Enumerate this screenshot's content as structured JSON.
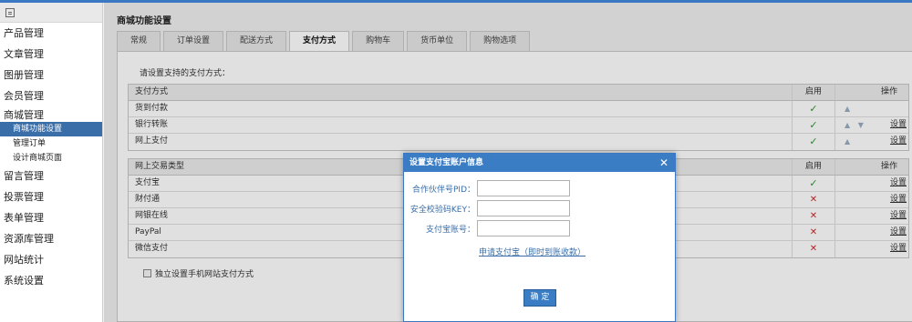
{
  "sidebar": {
    "items": [
      {
        "label": "产品管理"
      },
      {
        "label": "文章管理"
      },
      {
        "label": "图册管理"
      },
      {
        "label": "会员管理"
      },
      {
        "label": "商城管理"
      },
      {
        "label": "留言管理"
      },
      {
        "label": "投票管理"
      },
      {
        "label": "表单管理"
      },
      {
        "label": "资源库管理"
      },
      {
        "label": "网站统计"
      },
      {
        "label": "系统设置"
      }
    ],
    "subitems": [
      {
        "label": "商城功能设置"
      },
      {
        "label": "管理订单"
      },
      {
        "label": "设计商城页面"
      }
    ]
  },
  "page": {
    "title": "商城功能设置"
  },
  "tabs": [
    {
      "label": "常规"
    },
    {
      "label": "订单设置"
    },
    {
      "label": "配送方式"
    },
    {
      "label": "支付方式"
    },
    {
      "label": "购物车"
    },
    {
      "label": "货币单位"
    },
    {
      "label": "购物选项"
    }
  ],
  "panel": {
    "instruction": "请设置支持的支付方式：",
    "table1": {
      "headers": [
        "支付方式",
        "启用",
        "操作"
      ],
      "rows": [
        {
          "name": "货到付款",
          "enabled": true,
          "arrows": "▲",
          "action": ""
        },
        {
          "name": "银行转账",
          "enabled": true,
          "arrows": "▲ ▼",
          "action": "设置"
        },
        {
          "name": "网上支付",
          "enabled": true,
          "arrows": "▲",
          "action": "设置"
        }
      ]
    },
    "table2": {
      "headers": [
        "网上交易类型",
        "启用",
        "操作"
      ],
      "rows": [
        {
          "name": "支付宝",
          "enabled": true,
          "action": "设置"
        },
        {
          "name": "财付通",
          "enabled": false,
          "action": "设置"
        },
        {
          "name": "网银在线",
          "enabled": false,
          "action": "设置"
        },
        {
          "name": "PayPal",
          "enabled": false,
          "action": "设置"
        },
        {
          "name": "微信支付",
          "enabled": false,
          "action": "设置"
        }
      ]
    },
    "mobile_option": "独立设置手机网站支付方式"
  },
  "dialog": {
    "title": "设置支付宝账户信息",
    "close": "✕",
    "fields": {
      "partner_label": "合作伙伴号PID：",
      "key_label": "安全校验码KEY：",
      "account_label": "支付宝账号："
    },
    "apply_link": "申请支付宝（即时到账收款）",
    "ok": "确 定"
  },
  "icons": {
    "check": "✓",
    "cross": "✕"
  }
}
